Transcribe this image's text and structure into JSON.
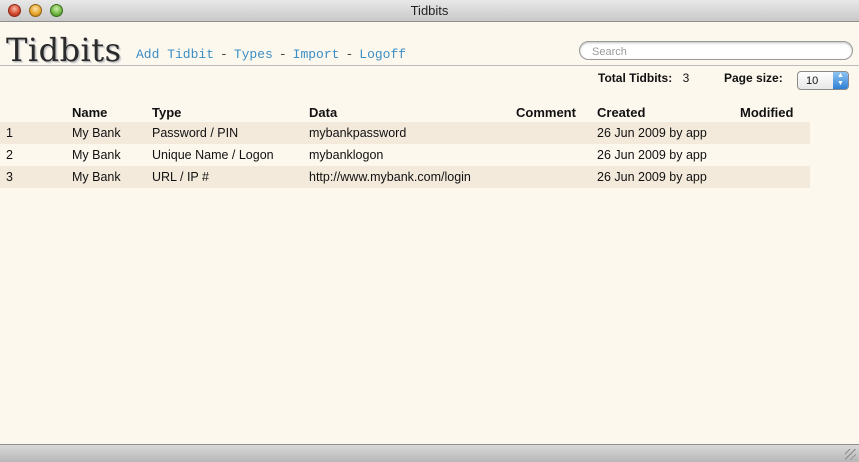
{
  "window": {
    "title": "Tidbits"
  },
  "app": {
    "logo": "Tidbits"
  },
  "nav": {
    "items": [
      "Add Tidbit",
      "Types",
      "Import",
      "Logoff"
    ],
    "separator": "-"
  },
  "search": {
    "placeholder": "Search",
    "value": ""
  },
  "stats": {
    "total_label": "Total Tidbits:",
    "total_value": "3",
    "page_size_label": "Page size:",
    "page_size_value": "10"
  },
  "table": {
    "columns": [
      "",
      "Name",
      "Type",
      "Data",
      "Comment",
      "Created",
      "Modified"
    ],
    "rows": [
      [
        "1",
        "My Bank",
        "Password / PIN",
        "mybankpassword",
        "",
        "26 Jun 2009 by app",
        ""
      ],
      [
        "2",
        "My Bank",
        "Unique Name / Logon",
        "mybanklogon",
        "",
        "26 Jun 2009 by app",
        ""
      ],
      [
        "3",
        "My Bank",
        "URL / IP #",
        "http://www.mybank.com/login",
        "",
        "26 Jun 2009 by app",
        ""
      ]
    ]
  },
  "colors": {
    "background": "#fdf8ee",
    "row_stripe": "#f4eadc",
    "link": "#3a8fc7"
  }
}
